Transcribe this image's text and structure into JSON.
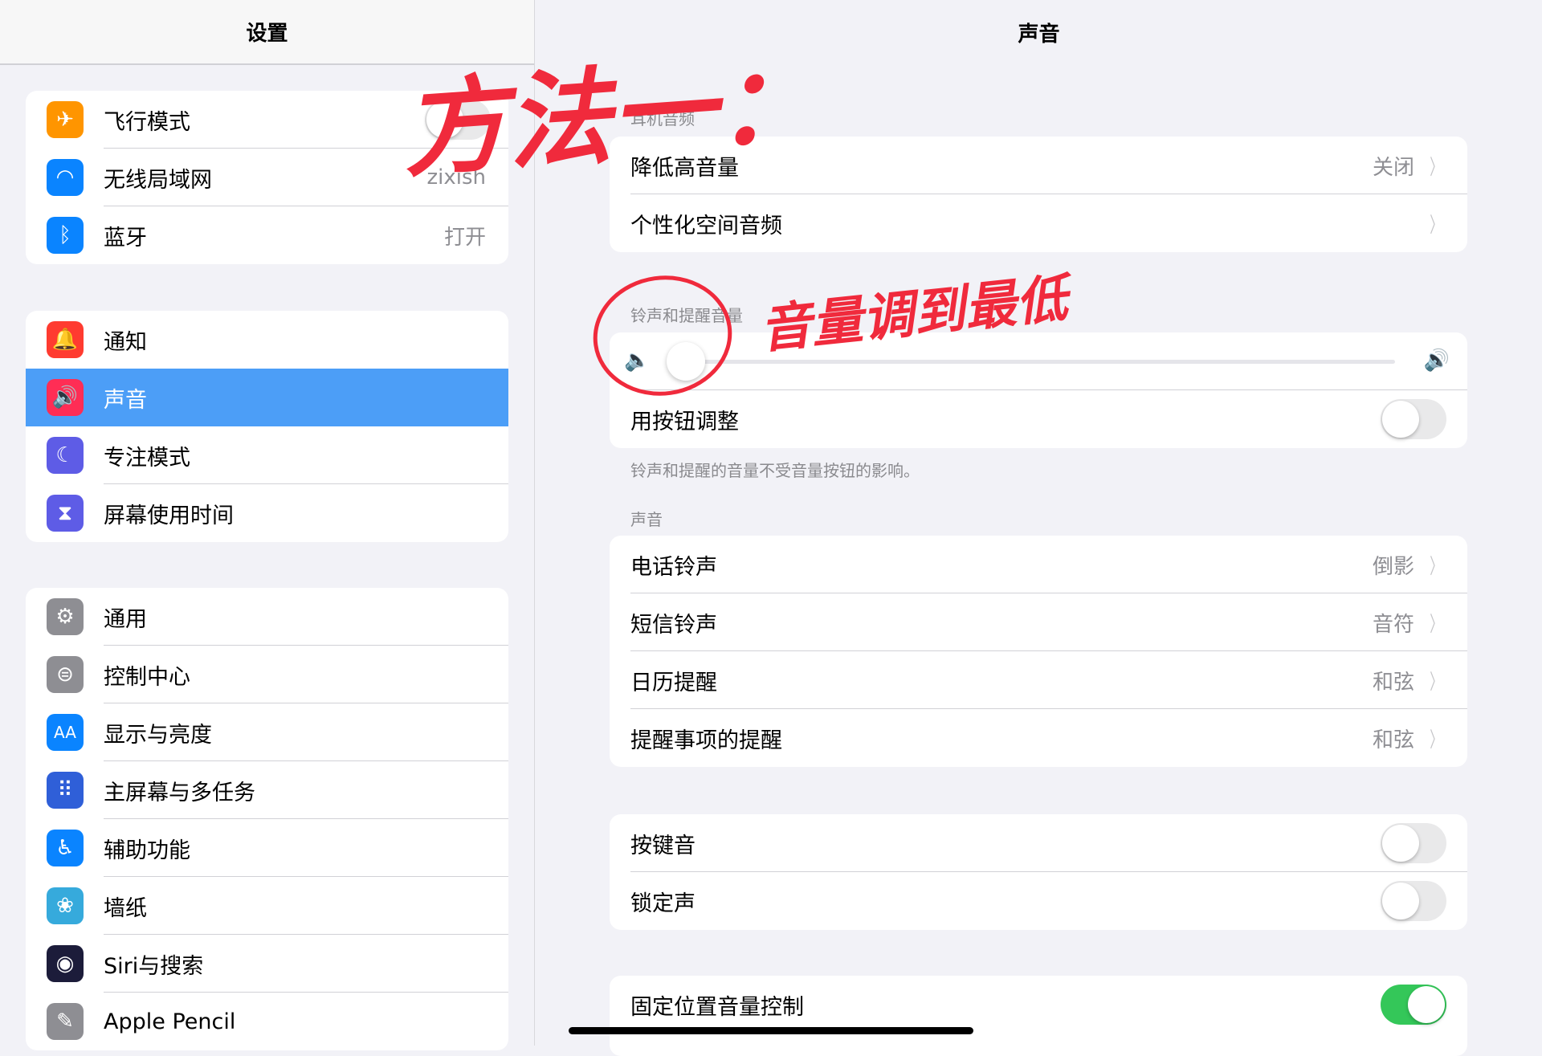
{
  "sidebar": {
    "title": "设置",
    "groups": [
      [
        {
          "label": "飞行模式",
          "icon": "airplane-icon",
          "color": "#ff9500",
          "glyph": "✈",
          "toggle": false
        },
        {
          "label": "无线局域网",
          "icon": "wifi-icon",
          "color": "#0a84ff",
          "glyph": "◠",
          "value": "zixish"
        },
        {
          "label": "蓝牙",
          "icon": "bluetooth-icon",
          "color": "#0a84ff",
          "glyph": "ᛒ",
          "value": "打开"
        }
      ],
      [
        {
          "label": "通知",
          "icon": "notification-bell-icon",
          "color": "#ff3b30",
          "glyph": "🔔"
        },
        {
          "label": "声音",
          "icon": "speaker-icon",
          "color": "#ff2d55",
          "glyph": "🔊",
          "selected": true
        },
        {
          "label": "专注模式",
          "icon": "moon-icon",
          "color": "#5e5ce6",
          "glyph": "☾"
        },
        {
          "label": "屏幕使用时间",
          "icon": "hourglass-icon",
          "color": "#5e5ce6",
          "glyph": "⧗"
        }
      ],
      [
        {
          "label": "通用",
          "icon": "gear-icon",
          "color": "#8e8e93",
          "glyph": "⚙"
        },
        {
          "label": "控制中心",
          "icon": "switches-icon",
          "color": "#8e8e93",
          "glyph": "⊜"
        },
        {
          "label": "显示与亮度",
          "icon": "text-size-icon",
          "color": "#0a84ff",
          "glyph": "AA"
        },
        {
          "label": "主屏幕与多任务",
          "icon": "home-grid-icon",
          "color": "#2f5fd8",
          "glyph": "⠿"
        },
        {
          "label": "辅助功能",
          "icon": "accessibility-icon",
          "color": "#0a84ff",
          "glyph": "♿"
        },
        {
          "label": "墙纸",
          "icon": "flower-icon",
          "color": "#36aadc",
          "glyph": "❀"
        },
        {
          "label": "Siri与搜索",
          "icon": "siri-icon",
          "color": "#1c1c3a",
          "glyph": "◉"
        },
        {
          "label": "Apple Pencil",
          "icon": "pencil-icon",
          "color": "#8e8e93",
          "glyph": "✎"
        }
      ]
    ]
  },
  "main": {
    "title": "声音",
    "headphone_label": "耳机音频",
    "headphone_rows": [
      {
        "label": "降低高音量",
        "value": "关闭"
      },
      {
        "label": "个性化空间音频",
        "value": ""
      }
    ],
    "ringer_label": "铃声和提醒音量",
    "ringer_volume": 0,
    "button_adjust_label": "用按钮调整",
    "button_adjust_on": false,
    "ringer_footnote": "铃声和提醒的音量不受音量按钮的影响。",
    "sounds_label": "声音",
    "sounds_rows": [
      {
        "label": "电话铃声",
        "value": "倒影"
      },
      {
        "label": "短信铃声",
        "value": "音符"
      },
      {
        "label": "日历提醒",
        "value": "和弦"
      },
      {
        "label": "提醒事项的提醒",
        "value": "和弦"
      }
    ],
    "toggle_rows": [
      {
        "label": "按键音",
        "on": false
      },
      {
        "label": "锁定声",
        "on": false
      }
    ],
    "fixed_row": {
      "label": "固定位置音量控制",
      "on": true
    }
  },
  "annotations": {
    "method": "方法一：",
    "instruction": "音量调到最低",
    "color": "#f02a3c"
  }
}
